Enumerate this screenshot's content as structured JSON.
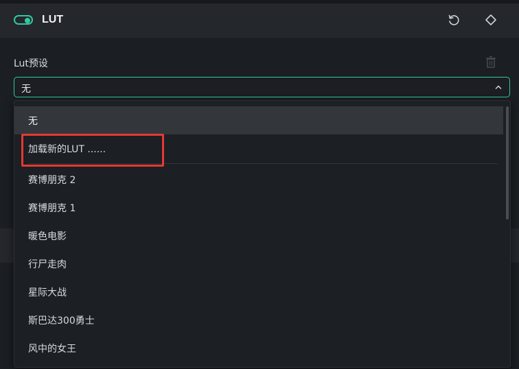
{
  "header": {
    "title": "LUT",
    "toggle_state": "on",
    "reset_icon": "reset-icon",
    "keyframe_icon": "keyframe-diamond-icon"
  },
  "lut": {
    "label": "Lut预设",
    "delete_icon": "trash-icon",
    "selected_value": "无",
    "chevron_icon": "chevron-up-icon"
  },
  "dropdown": {
    "items": [
      {
        "label": "无",
        "selected": true
      },
      {
        "label": "加载新的LUT ......",
        "selected": false
      },
      {
        "label": "赛博朋克 2",
        "selected": false
      },
      {
        "label": "赛博朋克 1",
        "selected": false
      },
      {
        "label": "暖色电影",
        "selected": false
      },
      {
        "label": "行尸走肉",
        "selected": false
      },
      {
        "label": "星际大战",
        "selected": false
      },
      {
        "label": "斯巴达300勇士",
        "selected": false
      },
      {
        "label": "风中的女王",
        "selected": false
      }
    ]
  },
  "colors": {
    "accent": "#33c9a2",
    "highlight": "#e53935",
    "panel_bg": "#1b1e22",
    "header_bg": "#24272b"
  }
}
